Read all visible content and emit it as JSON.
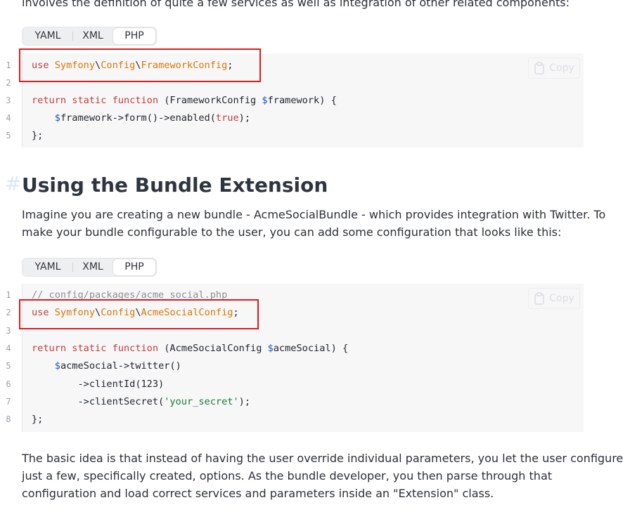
{
  "intro_cut": "involves the definition of quite a few services as well as integration of other related components:",
  "tabs": [
    "YAML",
    "XML",
    "PHP"
  ],
  "copy_label": "Copy",
  "block1": {
    "lines": [
      {
        "n": "1",
        "tokens": [
          [
            "k",
            "use "
          ],
          [
            "c",
            "Symfony"
          ],
          [
            "",
            "\\"
          ],
          [
            "c",
            "Config"
          ],
          [
            "",
            "\\"
          ],
          [
            "c",
            "FrameworkConfig"
          ],
          [
            "",
            ";"
          ]
        ]
      },
      {
        "n": "2",
        "tokens": []
      },
      {
        "n": "3",
        "tokens": [
          [
            "k",
            "return static function"
          ],
          [
            "",
            " (FrameworkConfig "
          ],
          [
            "v",
            "$"
          ],
          [
            "",
            "framework) {"
          ]
        ]
      },
      {
        "n": "4",
        "tokens": [
          [
            "",
            "    "
          ],
          [
            "v",
            "$"
          ],
          [
            "",
            "framework->form()->enabled("
          ],
          [
            "k",
            "true"
          ],
          [
            "",
            ");"
          ]
        ]
      },
      {
        "n": "5",
        "tokens": [
          [
            "",
            "};"
          ]
        ]
      }
    ]
  },
  "heading": {
    "anchor": "#",
    "text": "Using the Bundle Extension"
  },
  "paragraph1": [
    "Imagine you are creating a new bundle - AcmeSocialBundle - which provides integration with Twitter. To",
    "make your bundle configurable to the user, you can add some configuration that looks like this:"
  ],
  "block2": {
    "lines": [
      {
        "n": "1",
        "tokens": [
          [
            "cm",
            "// config/packages/acme_social.php"
          ]
        ]
      },
      {
        "n": "2",
        "tokens": [
          [
            "k",
            "use "
          ],
          [
            "c",
            "Symfony"
          ],
          [
            "",
            "\\"
          ],
          [
            "c",
            "Config"
          ],
          [
            "",
            "\\"
          ],
          [
            "c",
            "AcmeSocialConfig"
          ],
          [
            "",
            ";"
          ]
        ]
      },
      {
        "n": "3",
        "tokens": []
      },
      {
        "n": "4",
        "tokens": [
          [
            "k",
            "return static function"
          ],
          [
            "",
            " (AcmeSocialConfig "
          ],
          [
            "v",
            "$"
          ],
          [
            "",
            "acmeSocial) {"
          ]
        ]
      },
      {
        "n": "5",
        "tokens": [
          [
            "",
            "    "
          ],
          [
            "v",
            "$"
          ],
          [
            "",
            "acmeSocial->twitter()"
          ]
        ]
      },
      {
        "n": "6",
        "tokens": [
          [
            "",
            "        ->clientId(123)"
          ]
        ]
      },
      {
        "n": "7",
        "tokens": [
          [
            "",
            "        ->clientSecret("
          ],
          [
            "s",
            "'your_secret'"
          ],
          [
            "",
            ");"
          ]
        ]
      },
      {
        "n": "8",
        "tokens": [
          [
            "",
            "};"
          ]
        ]
      }
    ]
  },
  "paragraph2": [
    "The basic idea is that instead of having the user override individual parameters, you let the user configure",
    "just a few, specifically created, options. As the bundle developer, you then parse through that",
    "configuration and load correct services and parameters inside an \"Extension\" class."
  ]
}
